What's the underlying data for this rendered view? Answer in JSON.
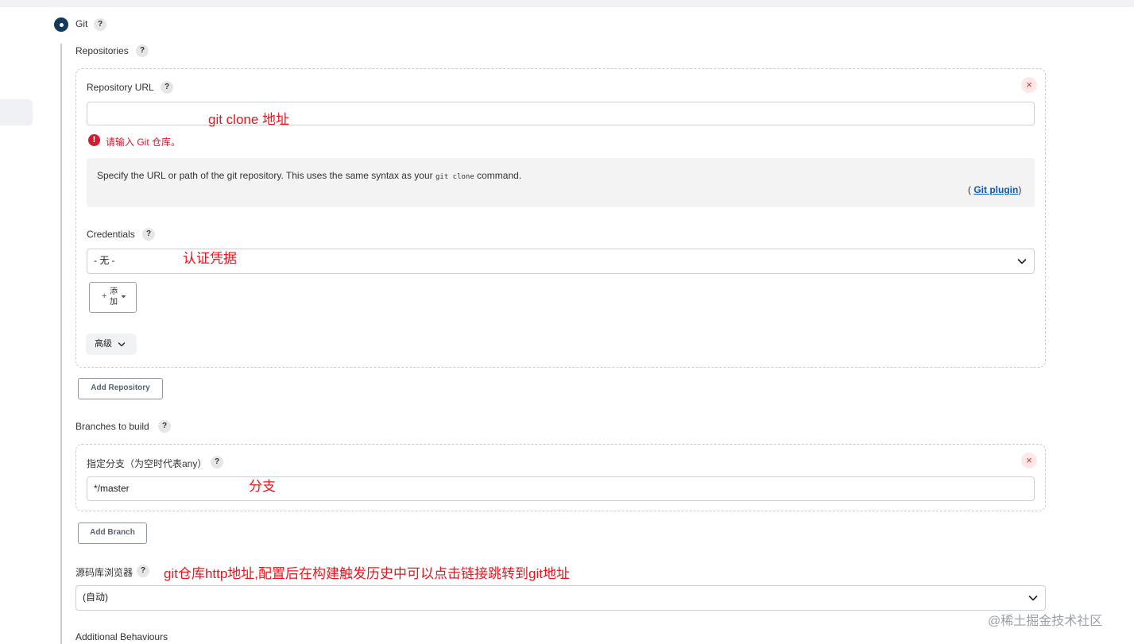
{
  "scm": {
    "git_label": "Git"
  },
  "repositories": {
    "label": "Repositories",
    "repository_url": {
      "label": "Repository URL",
      "value": "",
      "error": "请输入 Git 仓库。",
      "help_text_before": "Specify the URL or path of the git repository. This uses the same syntax as your",
      "help_code": "git clone",
      "help_text_after": "command.",
      "plugin_open": "(",
      "plugin_link": "Git plugin",
      "plugin_close": ")"
    },
    "credentials": {
      "label": "Credentials",
      "selected": "- 无 -",
      "add_label_line1": "添",
      "add_label_line2": "加"
    },
    "advanced_label": "高级",
    "add_repository_label": "Add Repository"
  },
  "branches": {
    "label": "Branches to build",
    "branch_specifier_label": "指定分支（为空时代表any）",
    "branch_value": "*/master",
    "add_branch_label": "Add Branch"
  },
  "browser": {
    "label": "源码库浏览器",
    "selected": "(自动)"
  },
  "additional_behaviours_label": "Additional Behaviours",
  "annotations": {
    "repo_url": "git clone 地址",
    "credentials": "认证凭据",
    "branch": "分支",
    "browser": "git仓库http地址,配置后在构建触发历史中可以点击链接跳转到git地址"
  },
  "help_symbol": "?",
  "close_symbol": "×",
  "error_symbol": "!",
  "watermark": "@稀土掘金技术社区",
  "colors": {
    "annotation": "#e4161e",
    "error": "#d6192d",
    "link": "#0a5bb5",
    "radio": "#15395b"
  }
}
